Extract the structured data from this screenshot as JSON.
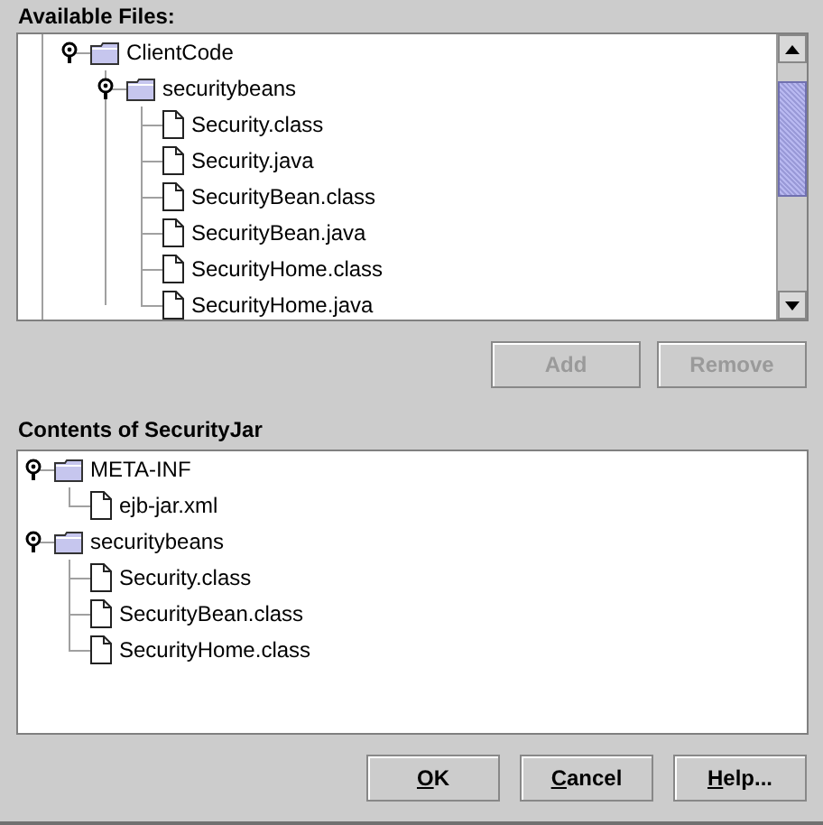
{
  "available_files": {
    "label": "Available Files:",
    "tree": [
      {
        "name": "ClientCode",
        "kind": "folder",
        "expanded": true,
        "children": [
          {
            "name": "securitybeans",
            "kind": "folder",
            "expanded": true,
            "children": [
              {
                "name": "Security.class",
                "kind": "file"
              },
              {
                "name": "Security.java",
                "kind": "file"
              },
              {
                "name": "SecurityBean.class",
                "kind": "file"
              },
              {
                "name": "SecurityBean.java",
                "kind": "file"
              },
              {
                "name": "SecurityHome.class",
                "kind": "file"
              },
              {
                "name": "SecurityHome.java",
                "kind": "file"
              }
            ]
          }
        ]
      }
    ]
  },
  "list_buttons": [
    {
      "label": "Add",
      "disabled": true
    },
    {
      "label": "Remove",
      "disabled": true
    }
  ],
  "contents": {
    "label": "Contents of SecurityJar",
    "tree": [
      {
        "name": "META-INF",
        "kind": "folder",
        "expanded": true,
        "children": [
          {
            "name": "ejb-jar.xml",
            "kind": "file"
          }
        ]
      },
      {
        "name": "securitybeans",
        "kind": "folder",
        "expanded": true,
        "children": [
          {
            "name": "Security.class",
            "kind": "file"
          },
          {
            "name": "SecurityBean.class",
            "kind": "file"
          },
          {
            "name": "SecurityHome.class",
            "kind": "file"
          }
        ]
      }
    ]
  },
  "dialog_buttons": [
    {
      "label": "OK",
      "underline_first": true
    },
    {
      "label": "Cancel",
      "underline_first": true
    },
    {
      "label": "Help...",
      "underline_first": true
    }
  ]
}
